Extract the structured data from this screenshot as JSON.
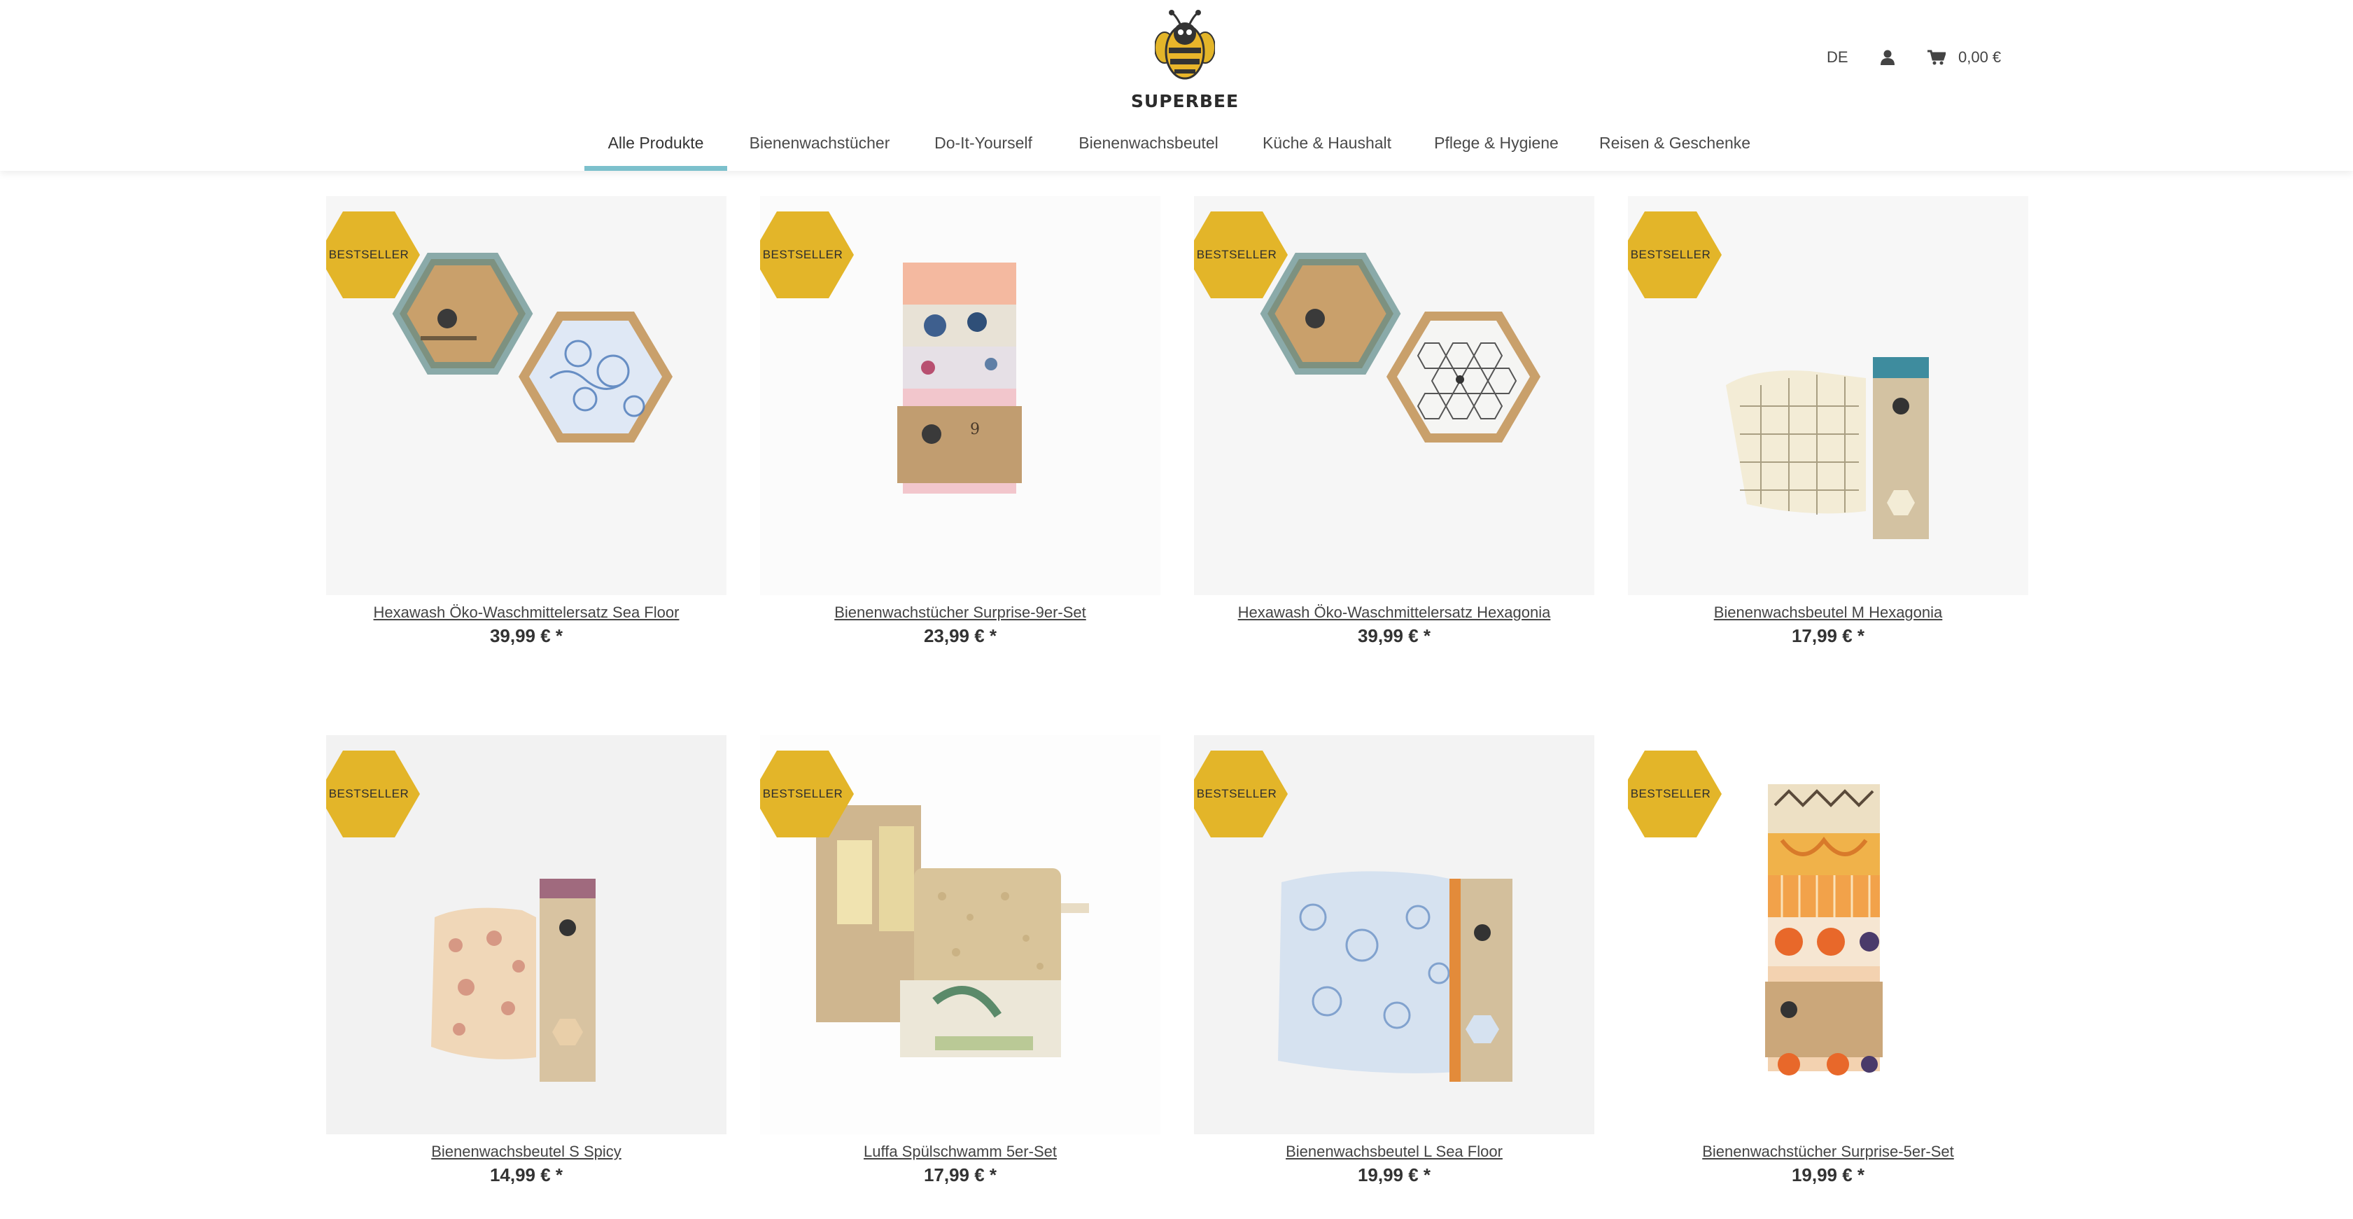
{
  "header": {
    "brand": "SUPERBEE",
    "language": "DE",
    "cart_total": "0,00 €"
  },
  "nav": {
    "items": [
      {
        "label": "Alle Produkte",
        "active": true
      },
      {
        "label": "Bienenwachstücher"
      },
      {
        "label": "Do-It-Yourself"
      },
      {
        "label": "Bienenwachsbeutel"
      },
      {
        "label": "Küche & Haushalt"
      },
      {
        "label": "Pflege & Hygiene"
      },
      {
        "label": "Reisen & Geschenke"
      }
    ]
  },
  "badge_label": "BESTSELLER",
  "products": [
    {
      "name": "Hexawash Öko-Waschmittelersatz Sea Floor",
      "price": "39,99 € *",
      "badge": "BESTSELLER"
    },
    {
      "name": "Bienenwachstücher Surprise-9er-Set",
      "price": "23,99 € *",
      "badge": "BESTSELLER"
    },
    {
      "name": "Hexawash Öko-Waschmittelersatz Hexagonia",
      "price": "39,99 € *",
      "badge": "BESTSELLER"
    },
    {
      "name": "Bienenwachsbeutel M Hexagonia",
      "price": "17,99 € *",
      "badge": "BESTSELLER"
    },
    {
      "name": "Bienenwachsbeutel S Spicy",
      "price": "14,99 € *",
      "badge": "BESTSELLER"
    },
    {
      "name": "Luffa Spülschwamm 5er-Set",
      "price": "17,99 € *",
      "badge": "BESTSELLER"
    },
    {
      "name": "Bienenwachsbeutel L Sea Floor",
      "price": "19,99 € *",
      "badge": "BESTSELLER"
    },
    {
      "name": "Bienenwachstücher Surprise-5er-Set",
      "price": "19,99 € *",
      "badge": "BESTSELLER"
    }
  ],
  "colors": {
    "badge": "#e3b529",
    "nav_active_underline": "#7cc0cc"
  },
  "icons": {
    "account": "user-icon",
    "cart": "shopping-cart-icon",
    "logo": "bee-logo"
  }
}
